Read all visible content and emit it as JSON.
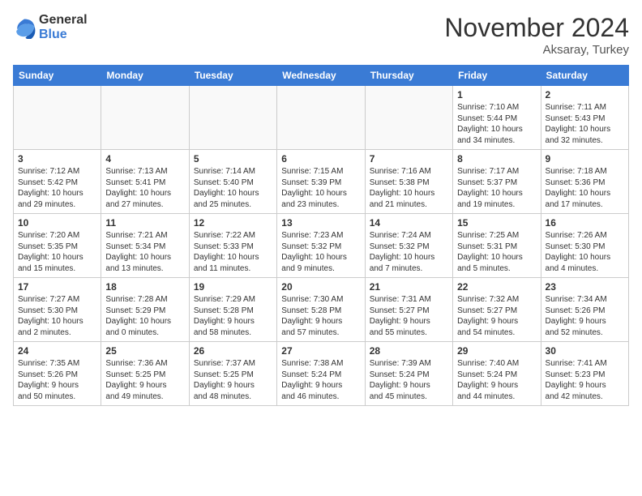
{
  "logo": {
    "general": "General",
    "blue": "Blue"
  },
  "title": "November 2024",
  "location": "Aksaray, Turkey",
  "days_of_week": [
    "Sunday",
    "Monday",
    "Tuesday",
    "Wednesday",
    "Thursday",
    "Friday",
    "Saturday"
  ],
  "weeks": [
    [
      {
        "day": "",
        "info": ""
      },
      {
        "day": "",
        "info": ""
      },
      {
        "day": "",
        "info": ""
      },
      {
        "day": "",
        "info": ""
      },
      {
        "day": "",
        "info": ""
      },
      {
        "day": "1",
        "info": "Sunrise: 7:10 AM\nSunset: 5:44 PM\nDaylight: 10 hours\nand 34 minutes."
      },
      {
        "day": "2",
        "info": "Sunrise: 7:11 AM\nSunset: 5:43 PM\nDaylight: 10 hours\nand 32 minutes."
      }
    ],
    [
      {
        "day": "3",
        "info": "Sunrise: 7:12 AM\nSunset: 5:42 PM\nDaylight: 10 hours\nand 29 minutes."
      },
      {
        "day": "4",
        "info": "Sunrise: 7:13 AM\nSunset: 5:41 PM\nDaylight: 10 hours\nand 27 minutes."
      },
      {
        "day": "5",
        "info": "Sunrise: 7:14 AM\nSunset: 5:40 PM\nDaylight: 10 hours\nand 25 minutes."
      },
      {
        "day": "6",
        "info": "Sunrise: 7:15 AM\nSunset: 5:39 PM\nDaylight: 10 hours\nand 23 minutes."
      },
      {
        "day": "7",
        "info": "Sunrise: 7:16 AM\nSunset: 5:38 PM\nDaylight: 10 hours\nand 21 minutes."
      },
      {
        "day": "8",
        "info": "Sunrise: 7:17 AM\nSunset: 5:37 PM\nDaylight: 10 hours\nand 19 minutes."
      },
      {
        "day": "9",
        "info": "Sunrise: 7:18 AM\nSunset: 5:36 PM\nDaylight: 10 hours\nand 17 minutes."
      }
    ],
    [
      {
        "day": "10",
        "info": "Sunrise: 7:20 AM\nSunset: 5:35 PM\nDaylight: 10 hours\nand 15 minutes."
      },
      {
        "day": "11",
        "info": "Sunrise: 7:21 AM\nSunset: 5:34 PM\nDaylight: 10 hours\nand 13 minutes."
      },
      {
        "day": "12",
        "info": "Sunrise: 7:22 AM\nSunset: 5:33 PM\nDaylight: 10 hours\nand 11 minutes."
      },
      {
        "day": "13",
        "info": "Sunrise: 7:23 AM\nSunset: 5:32 PM\nDaylight: 10 hours\nand 9 minutes."
      },
      {
        "day": "14",
        "info": "Sunrise: 7:24 AM\nSunset: 5:32 PM\nDaylight: 10 hours\nand 7 minutes."
      },
      {
        "day": "15",
        "info": "Sunrise: 7:25 AM\nSunset: 5:31 PM\nDaylight: 10 hours\nand 5 minutes."
      },
      {
        "day": "16",
        "info": "Sunrise: 7:26 AM\nSunset: 5:30 PM\nDaylight: 10 hours\nand 4 minutes."
      }
    ],
    [
      {
        "day": "17",
        "info": "Sunrise: 7:27 AM\nSunset: 5:30 PM\nDaylight: 10 hours\nand 2 minutes."
      },
      {
        "day": "18",
        "info": "Sunrise: 7:28 AM\nSunset: 5:29 PM\nDaylight: 10 hours\nand 0 minutes."
      },
      {
        "day": "19",
        "info": "Sunrise: 7:29 AM\nSunset: 5:28 PM\nDaylight: 9 hours\nand 58 minutes."
      },
      {
        "day": "20",
        "info": "Sunrise: 7:30 AM\nSunset: 5:28 PM\nDaylight: 9 hours\nand 57 minutes."
      },
      {
        "day": "21",
        "info": "Sunrise: 7:31 AM\nSunset: 5:27 PM\nDaylight: 9 hours\nand 55 minutes."
      },
      {
        "day": "22",
        "info": "Sunrise: 7:32 AM\nSunset: 5:27 PM\nDaylight: 9 hours\nand 54 minutes."
      },
      {
        "day": "23",
        "info": "Sunrise: 7:34 AM\nSunset: 5:26 PM\nDaylight: 9 hours\nand 52 minutes."
      }
    ],
    [
      {
        "day": "24",
        "info": "Sunrise: 7:35 AM\nSunset: 5:26 PM\nDaylight: 9 hours\nand 50 minutes."
      },
      {
        "day": "25",
        "info": "Sunrise: 7:36 AM\nSunset: 5:25 PM\nDaylight: 9 hours\nand 49 minutes."
      },
      {
        "day": "26",
        "info": "Sunrise: 7:37 AM\nSunset: 5:25 PM\nDaylight: 9 hours\nand 48 minutes."
      },
      {
        "day": "27",
        "info": "Sunrise: 7:38 AM\nSunset: 5:24 PM\nDaylight: 9 hours\nand 46 minutes."
      },
      {
        "day": "28",
        "info": "Sunrise: 7:39 AM\nSunset: 5:24 PM\nDaylight: 9 hours\nand 45 minutes."
      },
      {
        "day": "29",
        "info": "Sunrise: 7:40 AM\nSunset: 5:24 PM\nDaylight: 9 hours\nand 44 minutes."
      },
      {
        "day": "30",
        "info": "Sunrise: 7:41 AM\nSunset: 5:23 PM\nDaylight: 9 hours\nand 42 minutes."
      }
    ]
  ]
}
